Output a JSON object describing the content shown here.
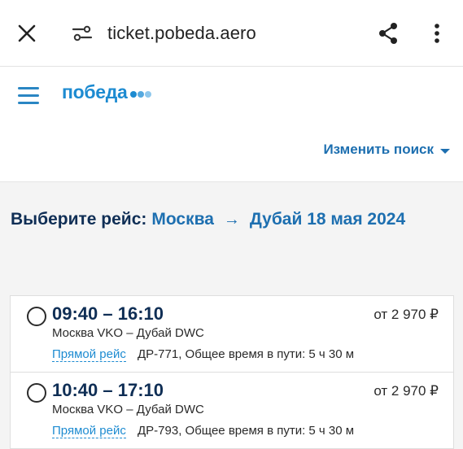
{
  "browser": {
    "url": "ticket.pobeda.aero",
    "icons": [
      "close-icon",
      "tune-icon",
      "share-icon",
      "more-vert-icon"
    ]
  },
  "header": {
    "logo_text": "победа",
    "logo_dot_colors": [
      "#1d8bd1",
      "#56a9df",
      "#8ec7ec"
    ],
    "change_search": "Изменить поиск"
  },
  "title": {
    "lead": "Выберите рейс:",
    "from": "Москва",
    "arrow": "→",
    "to_date": "Дубай 18 мая 2024"
  },
  "flights": [
    {
      "time": "09:40 – 16:10",
      "route": "Москва VKO – Дубай DWC",
      "direct": "Прямой рейс",
      "info": "ДР-771, Общее время в пути: 5 ч 30 м",
      "price": "от 2 970 ₽"
    },
    {
      "time": "10:40 – 17:10",
      "route": "Москва VKO – Дубай DWC",
      "direct": "Прямой рейс",
      "info": "ДР-793, Общее время в пути: 5 ч 30 м",
      "price": "от 2 970 ₽"
    }
  ],
  "colors": {
    "brand_blue": "#1d8bd1",
    "link_blue": "#1d6fb0",
    "navy": "#0f2e55"
  }
}
